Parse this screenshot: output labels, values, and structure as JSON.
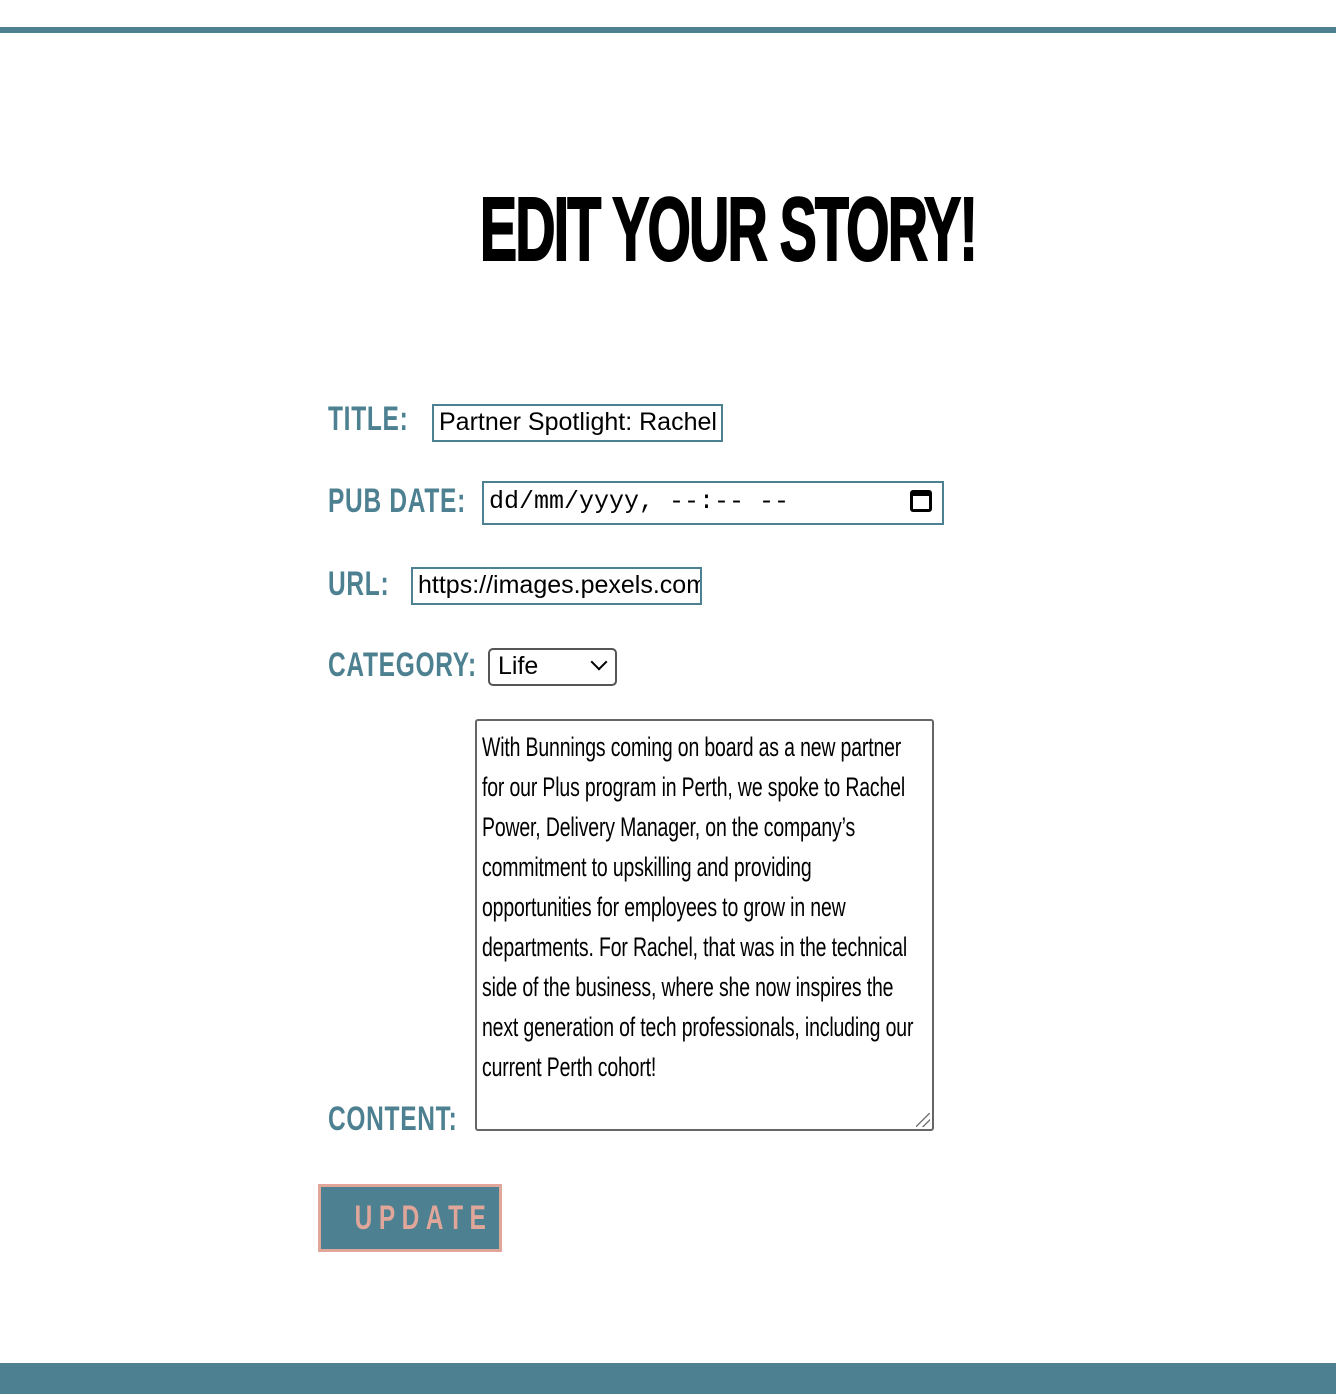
{
  "header": {
    "title": "Edit your story!"
  },
  "form": {
    "title_label": "Title:",
    "title_value": "Partner Spotlight: Rachel",
    "pub_date_label": "Pub Date:",
    "pub_date_placeholder": "dd/mm/yyyy, --:-- --",
    "url_label": "URL:",
    "url_value": "https://images.pexels.com",
    "category_label": "Category:",
    "category_selected": "Life",
    "content_label": "Content:",
    "content_value": "With Bunnings coming on board as a new partner for our Plus program in Perth, we spoke to Rachel Power, Delivery Manager, on the company’s commitment to upskilling and providing opportunities for employees to grow in new departments. For Rachel, that was in the technical side of the business, where she now inspires the next generation of tech professionals, including our current Perth cohort!",
    "submit_label": "Update"
  },
  "icons": {
    "calendar": "calendar-icon",
    "dropdown": "chevron-down-icon",
    "resize": "resize-handle-icon"
  },
  "colors": {
    "accent": "#4d8090",
    "button_text": "#e0a69a",
    "text": "#000000"
  }
}
